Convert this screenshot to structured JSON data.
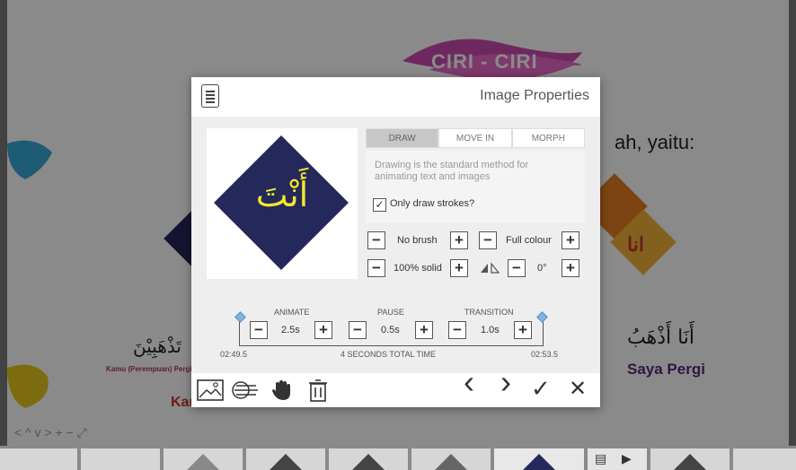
{
  "background": {
    "title": "CIRI - CIRI",
    "subtitle_fragment": "ah, yaitu:",
    "ana_label": "انا",
    "arabic_right": "أَنَا أَذْهَبُ",
    "saya_pergi": "Saya Pergi",
    "arabic_left": "تَذْهَبِيْنَ",
    "kamu_caption": "Kamu (Perempuan) Pergi",
    "kam_fragment": "Kam",
    "canvas_tools": "< ^ v >   + − ⤢"
  },
  "dialog": {
    "title": "Image Properties",
    "preview_text": "أَنْتَ",
    "tabs": [
      {
        "label": "DRAW"
      },
      {
        "label": "MOVE IN"
      },
      {
        "label": "MORPH"
      }
    ],
    "description": "Drawing is the standard method for animating text and images",
    "only_draw_strokes_label": "Only draw strokes?",
    "only_draw_strokes_checked": true,
    "check_mark": "✓",
    "brush_label": "No brush",
    "colour_label": "Full colour",
    "solid_label": "100% solid",
    "angle_label": "0°",
    "minus": "−",
    "plus": "+",
    "timeline": {
      "animate_label": "ANIMATE",
      "pause_label": "PAUSE",
      "transition_label": "TRANSITION",
      "animate_value": "2.5s",
      "pause_value": "0.5s",
      "transition_value": "1.0s",
      "start_time": "02:49.5",
      "total_label": "4 SECONDS TOTAL TIME",
      "end_time": "02:53.5"
    },
    "footer": {
      "prev": "‹",
      "next": "›",
      "confirm": "✓",
      "close": "✕"
    }
  },
  "colors": {
    "diamond_navy": "#24285a",
    "arabic_yellow": "#f2e72c",
    "accent_blue": "#7fb2e5"
  }
}
